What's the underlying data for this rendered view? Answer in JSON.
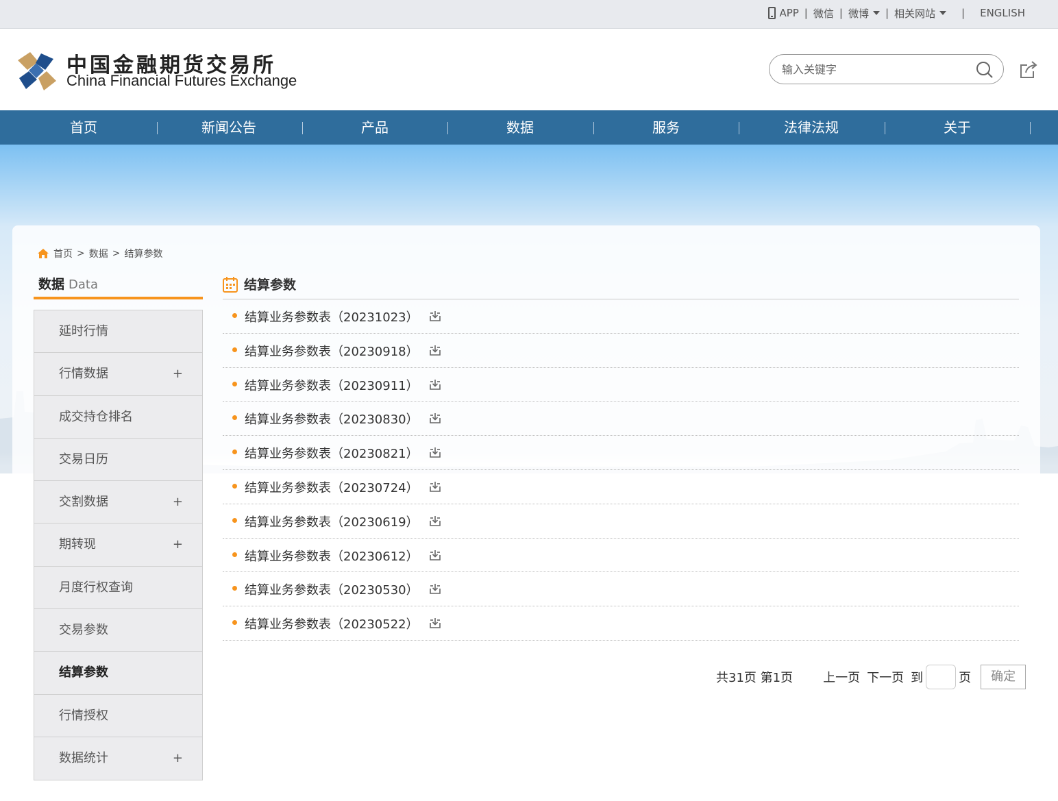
{
  "topbar": {
    "app": "APP",
    "wechat": "微信",
    "weibo": "微博",
    "related_sites": "相关网站",
    "english": "ENGLISH"
  },
  "header": {
    "logo_cn": "中国金融期货交易所",
    "logo_en": "China Financial Futures Exchange",
    "search_placeholder": "输入关键字"
  },
  "nav": [
    "首页",
    "新闻公告",
    "产品",
    "数据",
    "服务",
    "法律法规",
    "关于"
  ],
  "breadcrumb": [
    "首页",
    "数据",
    "结算参数"
  ],
  "sidebar": {
    "title": "数据",
    "title_en": "Data",
    "items": [
      {
        "label": "延时行情",
        "expand": ""
      },
      {
        "label": "行情数据",
        "expand": "+"
      },
      {
        "label": "成交持仓排名",
        "expand": ""
      },
      {
        "label": "交易日历",
        "expand": ""
      },
      {
        "label": "交割数据",
        "expand": "+"
      },
      {
        "label": "期转现",
        "expand": "+"
      },
      {
        "label": "月度行权查询",
        "expand": ""
      },
      {
        "label": "交易参数",
        "expand": ""
      },
      {
        "label": "结算参数",
        "expand": ""
      },
      {
        "label": "行情授权",
        "expand": ""
      },
      {
        "label": "数据统计",
        "expand": "+"
      }
    ]
  },
  "main": {
    "title": "结算参数",
    "items": [
      "结算业务参数表（20231023）",
      "结算业务参数表（20230918）",
      "结算业务参数表（20230911）",
      "结算业务参数表（20230830）",
      "结算业务参数表（20230821）",
      "结算业务参数表（20230724）",
      "结算业务参数表（20230619）",
      "结算业务参数表（20230612）",
      "结算业务参数表（20230530）",
      "结算业务参数表（20230522）"
    ]
  },
  "pager": {
    "info": "共31页 第1页",
    "prev": "上一页",
    "next": "下一页",
    "to": "到",
    "page_unit": "页",
    "confirm": "确定"
  },
  "colors": {
    "nav_bg": "#2f6d9c",
    "accent_orange": "#f7941d",
    "logo_blue": "#1f4e8c",
    "logo_gold": "#c9a063"
  }
}
